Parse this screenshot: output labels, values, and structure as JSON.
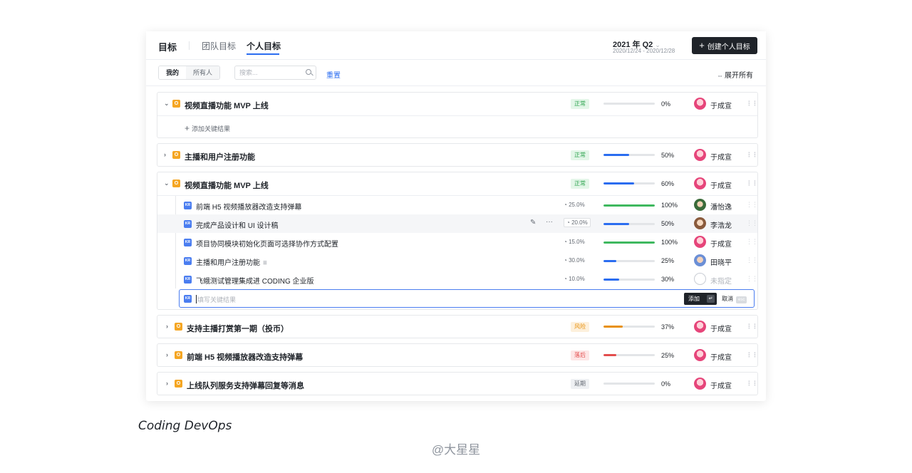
{
  "header": {
    "title": "目标",
    "tabs": [
      {
        "label": "团队目标"
      },
      {
        "label": "个人目标"
      }
    ],
    "quarter": "2021 年 Q2",
    "quarter_caret": "⌄",
    "quarter_range": "2020/12/24 - 2020/12/28",
    "create_label": "创建个人目标",
    "create_icon": "plus-icon"
  },
  "toolbar": {
    "filter_options": [
      "我的",
      "所有人"
    ],
    "search_placeholder": "搜索...",
    "reset_label": "重置",
    "expand_all_label": "展开所有"
  },
  "status_colors": {
    "正常": "#2ea44f",
    "风险": "#e8900c",
    "落后": "#e34d4d",
    "延期": "#646a73"
  },
  "objectives": [
    {
      "badge": "O",
      "title": "视频直播功能 MVP 上线",
      "status": "正常",
      "progress": 0,
      "progress_label": "0%",
      "owner": "于成宣",
      "expanded": true,
      "add_kr_label": "添加关键结果"
    },
    {
      "badge": "O",
      "title": "主播和用户注册功能",
      "status": "正常",
      "progress": 50,
      "progress_label": "50%",
      "owner": "于成宣",
      "expanded": false
    },
    {
      "badge": "O",
      "title": "视频直播功能 MVP 上线",
      "status": "正常",
      "progress": 60,
      "progress_label": "60%",
      "owner": "于成宣",
      "expanded": true,
      "key_results": [
        {
          "badge": "KR",
          "title": "前端 H5 视频播放器改造支持弹幕",
          "weight": "25.0%",
          "progress": 100,
          "progress_label": "100%",
          "owner": "潘怡逸",
          "bar_color": "#3fb85f"
        },
        {
          "badge": "KR",
          "title": "完成产品设计和 UI 设计稿",
          "weight": "20.0%",
          "progress": 50,
          "progress_label": "50%",
          "owner": "李浩龙",
          "bar_color": "#2b6df0"
        },
        {
          "badge": "KR",
          "title": "项目协同模块初始化页面可选择协作方式配置",
          "weight": "15.0%",
          "progress": 100,
          "progress_label": "100%",
          "owner": "于成宣",
          "bar_color": "#3fb85f"
        },
        {
          "badge": "KR",
          "title": "主播和用户注册功能",
          "weight": "30.0%",
          "progress": 25,
          "progress_label": "25%",
          "owner": "田晓平",
          "bar_color": "#2b6df0"
        },
        {
          "badge": "KR",
          "title": "飞蛾测试管理集成进 CODING 企业版",
          "weight": "10.0%",
          "progress": 30,
          "progress_label": "30%",
          "owner": "未指定",
          "bar_color": "#2b6df0"
        }
      ],
      "kr_input": {
        "placeholder": "填写关键结果",
        "add_label": "添加",
        "enter_key": "↵",
        "cancel_label": "取消",
        "esc_key": "esc"
      }
    },
    {
      "badge": "O",
      "title": "支持主播打赏第一期（投币）",
      "status": "风险",
      "progress": 37,
      "progress_label": "37%",
      "owner": "于成宣",
      "expanded": false
    },
    {
      "badge": "O",
      "title": "前端 H5 视频播放器改造支持弹幕",
      "status": "落后",
      "progress": 25,
      "progress_label": "25%",
      "owner": "于成宣",
      "expanded": false
    },
    {
      "badge": "O",
      "title": "上线队列服务支持弹幕回复等消息",
      "status": "延期",
      "progress": 0,
      "progress_label": "0%",
      "owner": "于成宣",
      "expanded": false
    }
  ],
  "caption": "Coding DevOps",
  "watermark": "@大星星"
}
